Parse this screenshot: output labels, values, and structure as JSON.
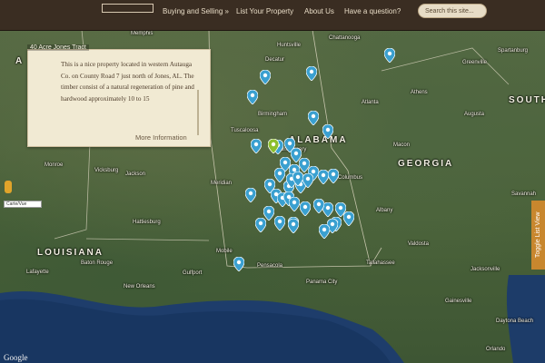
{
  "nav": {
    "items": [
      "Buying and Selling »",
      "List Your Property",
      "About Us",
      "Have a question?"
    ],
    "search_placeholder": "Search this site..."
  },
  "map": {
    "states": [
      "ALABAMA",
      "GEORGIA",
      "LOUISIANA",
      "SOUTH CAROLINA"
    ],
    "cities": [
      "Memphis",
      "Huntsville",
      "Chattanooga",
      "Greenville",
      "Spartanburg",
      "Decatur",
      "Birmingham",
      "Atlanta",
      "Athens",
      "Augusta",
      "Tuscaloosa",
      "Montgomery",
      "Columbus",
      "Macon",
      "Savannah",
      "Jackson",
      "Vicksburg",
      "Monroe",
      "Meridian",
      "Hattiesburg",
      "Albany",
      "Valdosta",
      "Tallahassee",
      "Jacksonville",
      "Mobile",
      "Pensacola",
      "Panama City",
      "Gulfport",
      "Baton Rouge",
      "New Orleans",
      "Lafayette",
      "Orlando",
      "Gainesville",
      "Daytona Beach"
    ],
    "popup_title": "40 Acre Jones Tract",
    "popup_text": "This is a nice property located in western Autauga Co. on County Road 7 just north of Jones, AL. The timber consist of a natural regeneration of pine and hardwood approximately 10 to 15",
    "more_label": "More Information",
    "toggle_label": "Toggle List View",
    "map_type_label": "Carte/Vue",
    "attribution": "Google"
  },
  "colors": {
    "pin": "#3aa0d0",
    "selected_pin": "#8dbf2e",
    "toggle": "#c8872e"
  }
}
